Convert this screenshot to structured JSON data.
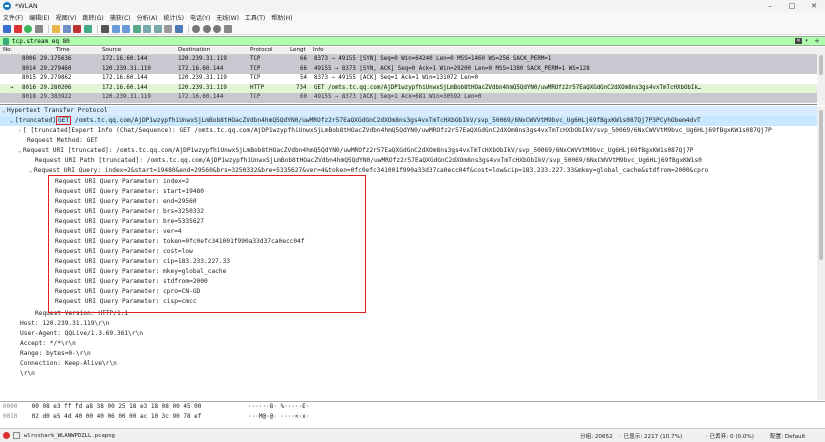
{
  "window": {
    "title": "*WLAN",
    "minimize": "–",
    "maximize": "□",
    "close": "✕"
  },
  "menu": [
    "文件(F)",
    "编辑(E)",
    "视图(V)",
    "跳转(G)",
    "捕获(C)",
    "分析(A)",
    "统计(S)",
    "电话(Y)",
    "无线(W)",
    "工具(T)",
    "帮助(H)"
  ],
  "filter": {
    "value": "tcp.stream eq 80",
    "clear": "✕",
    "dropdown": "▾",
    "add": "+"
  },
  "packet_list": {
    "headers": {
      "no": "No.",
      "time": "Time",
      "source": "Source",
      "destination": "Destination",
      "protocol": "Protocol",
      "length": "Lengt",
      "info": "Info"
    },
    "rows": [
      {
        "no": "8006",
        "time": "29.175636",
        "source": "172.16.60.144",
        "destination": "120.239.31.119",
        "protocol": "TCP",
        "length": "66",
        "info": "8373 → 49155 [SYN] Seq=0 Win=64240 Len=0 MSS=1460 WS=256 SACK_PERM=1"
      },
      {
        "no": "8014",
        "time": "29.279460",
        "source": "120.239.31.119",
        "destination": "172.16.60.144",
        "protocol": "TCP",
        "length": "66",
        "info": "49155 → 8373 [SYN, ACK] Seq=0 Ack=1 Win=29200 Len=0 MSS=1380 SACK_PERM=1 WS=128"
      },
      {
        "no": "8015",
        "time": "29.279862",
        "source": "172.16.60.144",
        "destination": "120.239.31.119",
        "protocol": "TCP",
        "length": "54",
        "info": "8373 → 49155 [ACK] Seq=1 Ack=1 Win=131072 Len=0"
      },
      {
        "no": "8016",
        "time": "29.280206",
        "source": "172.16.60.144",
        "destination": "120.239.31.119",
        "protocol": "HTTP",
        "length": "734",
        "info": "GET /omts.tc.qq.com/AjDP1wzypfhiUnwxSjLmBob8tHOacZVdbn4hmQ5QdYN0/uwMROfz2r57EaQXGdGnC2dXOm8ns3gs4vxTmTcHXbObIk…"
      },
      {
        "no": "8018",
        "time": "29.383922",
        "source": "120.239.31.119",
        "destination": "172.16.60.144",
        "protocol": "TCP",
        "length": "60",
        "info": "49155 → 8373 [ACK] Seq=1 Ack=681 Win=30592 Len=0"
      }
    ]
  },
  "details": {
    "http_header": "Hypertext Transfer Protocol",
    "request_line_prefix": "[truncated]",
    "request_line_method": "GET",
    "request_line_rest": " /omts.tc.qq.com/AjDP1wzypfhiUnwxSjLmBob8tHOacZVdbn4hmQ5QdYN0/uwMROfz2r57EaQXGdGnC2dXOm8ns3gs4vxTmTcHXbObIkV/svp_50069/6NxCWVVtM9bvc_Ug6HLj69fBgxKW1s087Qj7P3PCyhObem4dvT",
    "expert_info": "[ [truncated]Expert Info (Chat/Sequence): GET /omts.tc.qq.com/AjDP1wzypfhiUnwxSjLmBob8tHOacZVdbn4hmQ5QdYN0/uwMROfz2r57EaQXGdGnC2dXOm8ns3gs4vxTmTcHXbObIkV/svp_50069/6NxCWVVtM9bvc_Ug6HLj69fBgxKW1s087Qj7P",
    "request_method": "Request Method: GET",
    "request_uri": "Request URI [truncated]: /omts.tc.qq.com/AjDP1wzypfhiUnwxSjLmBob8tHOacZVdbn4hmQ5QdYN0/uwMROfz2r57EaQXGdGnC2dXOm8ns3gs4vxTmTcHXbObIkV/svp_50069/6NxCWVVtM9bvc_Ug6HLj69fBgxKW1s087Qj7P",
    "request_uri_path": "Request URI Path [truncated]: /omts.tc.qq.com/AjDP1wzypfhiUnwxSjLmBob8tHOacZVdbn4hmQ5QdYN0/uwMROfz2r57EaQXGdGnC2dXOm8ns3gs4vxTmTcHXbObIkV/svp_50069/6NxCWVVtM9bvc_Ug6HLj69fBgxKW1s0",
    "request_uri_query": "Request URI Query: index=2&start=19480&end=29560&brs=3250332&bre=5335627&ver=4&token=0fc0efc341001f990a33d37ca0ecc04f&cost=low&cip=183.233.227.33&mkey=global_cache&stdfrom=2000&cpro",
    "params": [
      "Request URI Query Parameter: index=2",
      "Request URI Query Parameter: start=19480",
      "Request URI Query Parameter: end=29560",
      "Request URI Query Parameter: brs=3250332",
      "Request URI Query Parameter: bre=5335627",
      "Request URI Query Parameter: ver=4",
      "Request URI Query Parameter: token=0fc0efc341001f990a33d37ca0ecc04f",
      "Request URI Query Parameter: cost=low",
      "Request URI Query Parameter: cip=183.233.227.33",
      "Request URI Query Parameter: mkey=global_cache",
      "Request URI Query Parameter: stdfrom=2000",
      "Request URI Query Parameter: cpro=CN-GD",
      "Request URI Query Parameter: cisp=cmcc"
    ],
    "request_version": "Request Version: HTTP/1.1",
    "host": "Host: 120.239.31.119\\r\\n",
    "user_agent": "User-Agent: QQLive/1.3.69.361\\r\\n",
    "accept": "Accept: */*\\r\\n",
    "range": "Range: bytes=0-\\r\\n",
    "connection": "Connection: Keep-Alive\\r\\n",
    "crlf": "\\r\\n"
  },
  "bytes": [
    {
      "offset": "0000",
      "hex": "00 08 e3 ff fd a8 38 00  25 18 e3 18 08 00 45 00",
      "ascii": "······8· %·····E·"
    },
    {
      "offset": "0010",
      "hex": "02 d0 e5 4d 40 00 40 06  00 00 ac 10 3c 90 78 ef",
      "ascii": "···M@·@· ····<·x·"
    }
  ],
  "status": {
    "file": "wlroshark_WLANWPDZLL.pcapng",
    "packets": "分组: 20652",
    "displayed": "· 已显示: 2217 (10.7%)",
    "marked": "· 已丢弃: 0 (0.0%)",
    "profile": "配置: Default"
  },
  "colors": {
    "accent": "#1679c2",
    "filter_ok": "#afffaf",
    "highlight": "#e02020",
    "selected": "#c7e8ff"
  }
}
